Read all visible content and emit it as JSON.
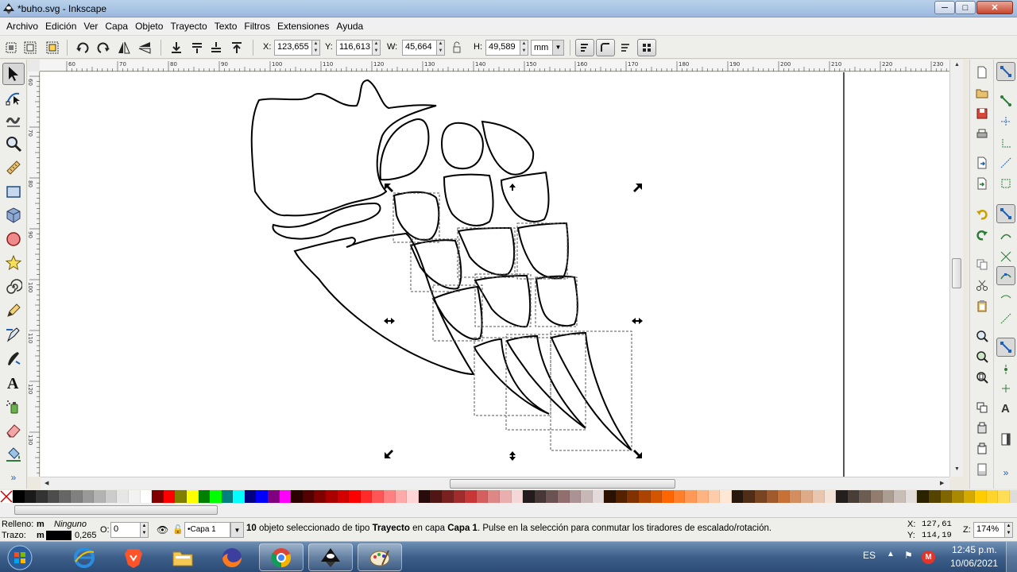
{
  "window": {
    "title": "*buho.svg - Inkscape",
    "controls": {
      "minimize": "─",
      "maximize": "□",
      "close": "✕"
    }
  },
  "menu": [
    "Archivo",
    "Edición",
    "Ver",
    "Capa",
    "Objeto",
    "Trayecto",
    "Texto",
    "Filtros",
    "Extensiones",
    "Ayuda"
  ],
  "selector_toolbar": {
    "x_label": "X:",
    "x_value": "123,655",
    "y_label": "Y:",
    "y_value": "116,613",
    "w_label": "W:",
    "w_value": "45,664",
    "h_label": "H:",
    "h_value": "49,589",
    "unit": "mm",
    "lock_icon": "lock-icon"
  },
  "rulers": {
    "top_ticks": [
      "60",
      "70",
      "80",
      "90",
      "100",
      "110",
      "120",
      "130",
      "140",
      "150",
      "160",
      "170",
      "180",
      "190",
      "200",
      "210",
      "220",
      "230"
    ],
    "left_ticks": [
      "60",
      "70",
      "80",
      "90",
      "100",
      "110",
      "120",
      "130",
      "140",
      "150"
    ]
  },
  "tools": [
    "selector-tool",
    "node-tool",
    "tweak-tool",
    "zoom-tool",
    "measure-tool",
    "rectangle-tool",
    "box3d-tool",
    "ellipse-tool",
    "star-tool",
    "spiral-tool",
    "pencil-tool",
    "pen-tool",
    "calligraphy-tool",
    "text-tool",
    "spray-tool",
    "eraser-tool",
    "paint-bucket-tool"
  ],
  "palette": [
    "#000000",
    "#1a1a1a",
    "#333333",
    "#4d4d4d",
    "#666666",
    "#808080",
    "#999999",
    "#b3b3b3",
    "#cccccc",
    "#e6e6e6",
    "#f2f2f2",
    "#ffffff",
    "#800000",
    "#ff0000",
    "#808000",
    "#ffff00",
    "#008000",
    "#00ff00",
    "#008080",
    "#00ffff",
    "#000080",
    "#0000ff",
    "#800080",
    "#ff00ff",
    "#2b0000",
    "#550000",
    "#800000",
    "#aa0000",
    "#d40000",
    "#ff0000",
    "#ff2a2a",
    "#ff5555",
    "#ff8080",
    "#ffaaaa",
    "#ffd5d5",
    "#280b0b",
    "#501616",
    "#782121",
    "#a02c2c",
    "#c83737",
    "#d35f5f",
    "#de8787",
    "#e9afaf",
    "#f4d7d7",
    "#241c1c",
    "#483737",
    "#6c5353",
    "#916f6f",
    "#ac9393",
    "#c8b7b7",
    "#e3dbdb",
    "#2b1100",
    "#552200",
    "#803300",
    "#aa4400",
    "#d45500",
    "#ff6600",
    "#ff7f2a",
    "#ff9955",
    "#ffb380",
    "#ffccaa",
    "#ffe6d5",
    "#28170b",
    "#502d16",
    "#784421",
    "#a05a2c",
    "#c87137",
    "#d38d5f",
    "#deaa87",
    "#e9c6af",
    "#f4e3d7",
    "#241f1c",
    "#483e37",
    "#6c5d53",
    "#917c6f",
    "#ac9d93",
    "#c8beb7",
    "#e3dedb",
    "#2b2200",
    "#554400",
    "#806600",
    "#aa8800",
    "#d4aa00",
    "#ffcc00",
    "#ffd42a",
    "#ffdd55"
  ],
  "status": {
    "fill_label": "Relleno:",
    "fill_value": "m",
    "fill_text": "Ninguno",
    "stroke_label": "Trazo:",
    "stroke_value": "m",
    "stroke_width": "0,265",
    "opacity_label": "O:",
    "opacity_value": "0",
    "layer": "•Capa 1",
    "message_count": "10",
    "message_a": " objeto seleccionado de tipo ",
    "message_type": "Trayecto",
    "message_b": " en capa ",
    "message_layer": "Capa 1",
    "message_c": ". Pulse en la selección para conmutar los tiradores de escalado/rotación.",
    "cursor_x_label": "X:",
    "cursor_x": "127,61",
    "cursor_y_label": "Y:",
    "cursor_y": "114,19",
    "zoom_label": "Z:",
    "zoom_value": "174%"
  },
  "taskbar": {
    "lang": "ES",
    "time": "12:45 p.m.",
    "date": "10/06/2021",
    "apps": [
      "internet-explorer-icon",
      "brave-icon",
      "file-explorer-icon",
      "firefox-icon",
      "chrome-icon",
      "inkscape-icon",
      "paint-icon"
    ]
  }
}
